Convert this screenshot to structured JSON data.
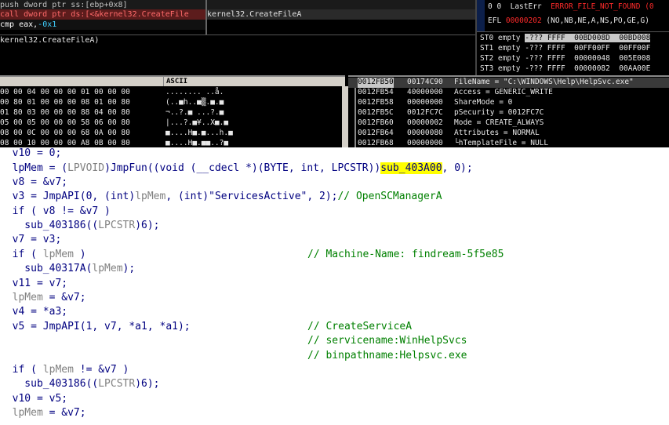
{
  "debugger": {
    "disasm": {
      "line1": "push dword ptr ss:[ebp+0x8]",
      "line2_instr": "call dword ptr ds:[<&kernel32.CreateFile",
      "line2_target": "kernel32.CreateFileA",
      "line3_prefix": "cmp eax,",
      "line3_hex": "-0x1",
      "line4": "              ",
      "info": "kernel32.CreateFileA)"
    },
    "registers": {
      "lasterr_label": "0 0  LastErr",
      "lasterr_value": "ERROR_FILE_NOT_FOUND (0",
      "efl_label": "EFL",
      "efl_value": "00000202",
      "efl_flags": "(NO,NB,NE,A,NS,PO,GE,G)",
      "st0_label": "ST0 empty",
      "st0_value": "-??? FFFF  00BD008D  00BD008",
      "st1": "ST1 empty -??? FFFF  00FF00FF  00FF00F",
      "st2": "ST2 empty -??? FFFF  00000048  005E008",
      "st3": "ST3 empty -??? FFFF  00000082  00AA00E"
    },
    "dump": {
      "ascii_title": "ASCII",
      "rows": [
        {
          "hex": "00 00 04 00 00 00 01 00 00 00",
          "ascii": "........ ..å."
        },
        {
          "hex": "00 80 01 00 00 00 08 01 00 80",
          "ascii": "(..■h..■▒.■.■"
        },
        {
          "hex": "01 80 03 00 00 00 88 04 00 80",
          "ascii": "¬..?.■ ...?.■"
        },
        {
          "hex": "05 00 05 00 00 00 58 06 00 80",
          "ascii": "|...?.■¥..X■.■"
        },
        {
          "hex": "08 00 0C 00 00 00 68 0A 00 80",
          "ascii": "■....H■.■...h.■"
        },
        {
          "hex": "08 00 10 00 00 00 A8 0B 00 80",
          "ascii": "■....H■.■■..?■"
        }
      ]
    },
    "stack": {
      "rows": [
        {
          "addr": "0012FB50",
          "val": "00174C90",
          "cmt": "FileName = \"C:\\WINDOWS\\Help\\HelpSvc.exe\""
        },
        {
          "addr": "0012FB54",
          "val": "40000000",
          "cmt": "Access = GENERIC_WRITE"
        },
        {
          "addr": "0012FB58",
          "val": "00000000",
          "cmt": "ShareMode = 0"
        },
        {
          "addr": "0012FB5C",
          "val": "0012FC7C",
          "cmt": "pSecurity = 0012FC7C"
        },
        {
          "addr": "0012FB60",
          "val": "00000002",
          "cmt": "Mode = CREATE_ALWAYS"
        },
        {
          "addr": "0012FB64",
          "val": "00000080",
          "cmt": "Attributes = NORMAL"
        },
        {
          "addr": "0012FB68",
          "val": "00000000",
          "cmt": "└hTemplateFile = NULL"
        }
      ]
    }
  },
  "code": {
    "l1": "  v10 = 0;",
    "l2_a": "  lpMem = (",
    "l2_b": "LPVOID",
    "l2_c": ")JmpFun((void (__cdecl *)(BYTE, int, LPCSTR))",
    "l2_sub": "sub_403A00",
    "l2_d": ", 0);",
    "l3": "  v8 = &v7;",
    "l4_a": "  v3 = JmpAPI(0, (int)",
    "l4_b": "lpMem",
    "l4_c": ", (int)\"ServicesActive\", 2);",
    "l4_cmt": "// OpenSCManagerA",
    "l5": "  if ( v8 != &v7 )",
    "l6_a": "    sub_403186((",
    "l6_b": "LPCSTR",
    "l6_c": ")6);",
    "l7": "  v7 = v3;",
    "l8_a": "  if ( ",
    "l8_b": "lpMem",
    "l8_c": " )",
    "l8_cmt": "// Machine-Name: findream-5f5e85",
    "l9_a": "    sub_40317A(",
    "l9_b": "lpMem",
    "l9_c": ");",
    "l10": "  v11 = v7;",
    "l11_a": "  ",
    "l11_b": "lpMem",
    "l11_c": " = &v7;",
    "l12": "  v4 = *a3;",
    "l13": "  v5 = JmpAPI(1, v7, *a1, *a1);",
    "l13_cmt": "// CreateServiceA",
    "l14_cmt": "// servicename:WinHelpSvcs",
    "l15_cmt": "// binpathname:Helpsvc.exe",
    "l16_a": "  if ( ",
    "l16_b": "lpMem",
    "l16_c": " != &v7 )",
    "l17_a": "    sub_403186((",
    "l17_b": "LPCSTR",
    "l17_c": ")6);",
    "l18": "  v10 = v5;",
    "l19_a": "  ",
    "l19_b": "lpMem",
    "l19_c": " = &v7;"
  }
}
